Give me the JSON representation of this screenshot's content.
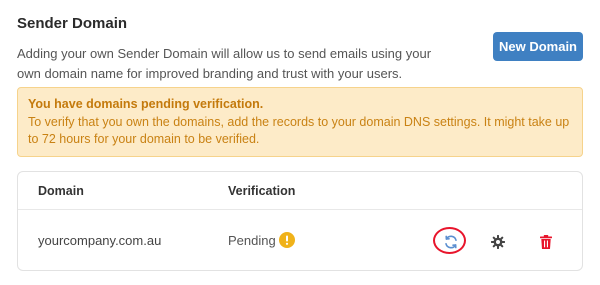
{
  "section": {
    "title": "Sender Domain",
    "description": "Adding your own Sender Domain will allow us to send emails using your own domain name for improved branding and trust with your users.",
    "new_domain_label": "New Domain"
  },
  "alert": {
    "title": "You have domains pending verification.",
    "body": "To verify that you own the domains, add the records to your domain DNS settings. It might take up to 72 hours for your domain to be verified."
  },
  "table": {
    "headers": {
      "domain": "Domain",
      "verification": "Verification"
    },
    "rows": [
      {
        "domain": "yourcompany.com.au",
        "verification": "Pending",
        "status_icon": "warning-icon",
        "actions": [
          "refresh-icon",
          "gear-icon",
          "trash-icon"
        ]
      }
    ]
  },
  "colors": {
    "primary": "#3f80c2",
    "warning_bg": "#fdebc8",
    "warning_text": "#c98214",
    "warning_icon": "#f0b21a",
    "delete": "#e8152c",
    "highlight": "#e8152c"
  }
}
